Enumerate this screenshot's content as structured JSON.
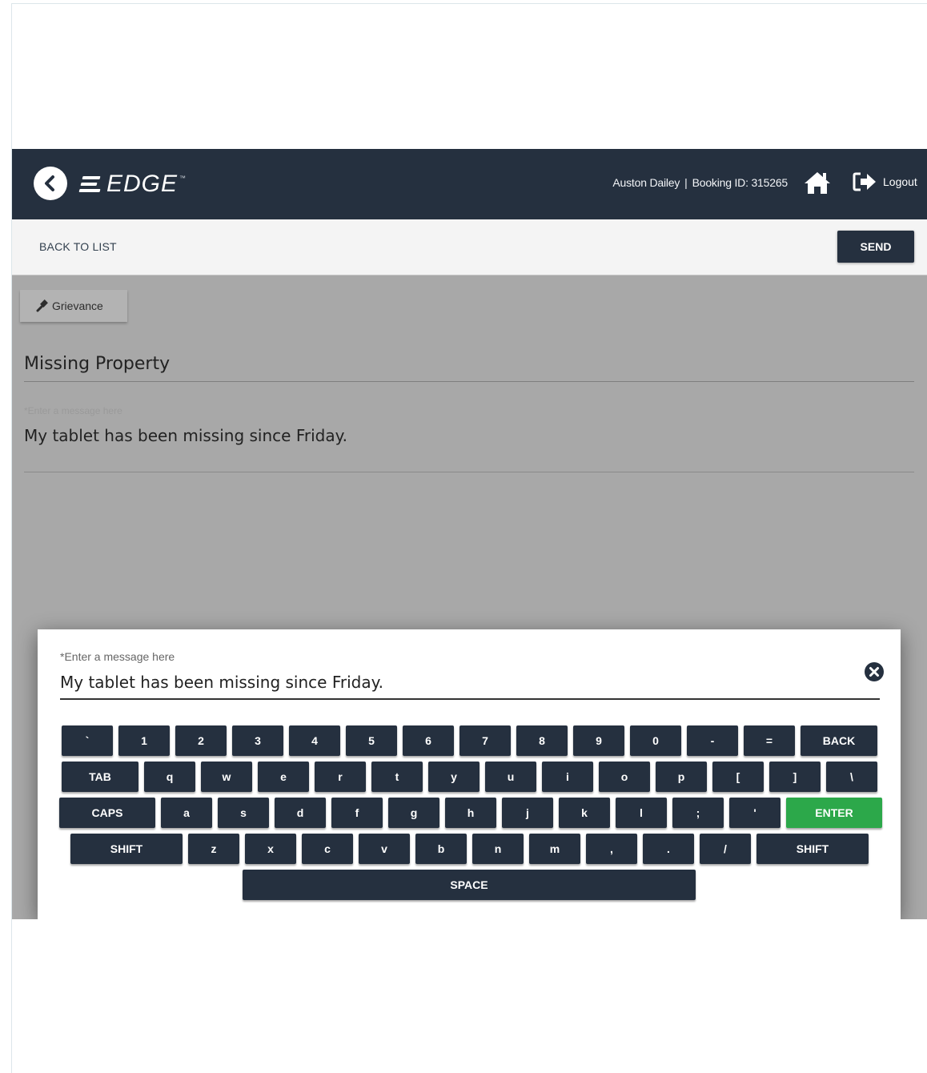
{
  "header": {
    "logo_text": "EDGE",
    "logo_mark": "™",
    "user_name": "Auston Dailey",
    "separator": "|",
    "booking_label": "Booking ID: 315265",
    "logout_label": "Logout"
  },
  "actionbar": {
    "back_label": "BACK TO LIST",
    "send_label": "SEND"
  },
  "form": {
    "category": "Grievance",
    "subject": "Missing Property",
    "message_label": "*Enter a message here",
    "message_value": "My tablet has been missing since Friday."
  },
  "keyboard": {
    "input_label": "*Enter a message here",
    "input_value": "My tablet has been missing since Friday.",
    "rows": [
      [
        "`",
        "1",
        "2",
        "3",
        "4",
        "5",
        "6",
        "7",
        "8",
        "9",
        "0",
        "-",
        "=",
        "BACK"
      ],
      [
        "TAB",
        "q",
        "w",
        "e",
        "r",
        "t",
        "y",
        "u",
        "i",
        "o",
        "p",
        "[",
        "]",
        "\\"
      ],
      [
        "CAPS",
        "a",
        "s",
        "d",
        "f",
        "g",
        "h",
        "j",
        "k",
        "l",
        ";",
        "'",
        "ENTER"
      ],
      [
        "SHIFT",
        "z",
        "x",
        "c",
        "v",
        "b",
        "n",
        "m",
        ",",
        ".",
        "/",
        "SHIFT"
      ],
      [
        "SPACE"
      ]
    ]
  },
  "colors": {
    "header_bg": "#25303f",
    "key_bg": "#25303f",
    "enter_bg": "#2ca84a",
    "overlay_bg": "#a8a8a8"
  },
  "icons": {
    "back": "chevron-left-circle-icon",
    "home": "home-icon",
    "logout": "sign-out-icon",
    "category": "gavel-icon",
    "close": "close-circle-icon"
  }
}
